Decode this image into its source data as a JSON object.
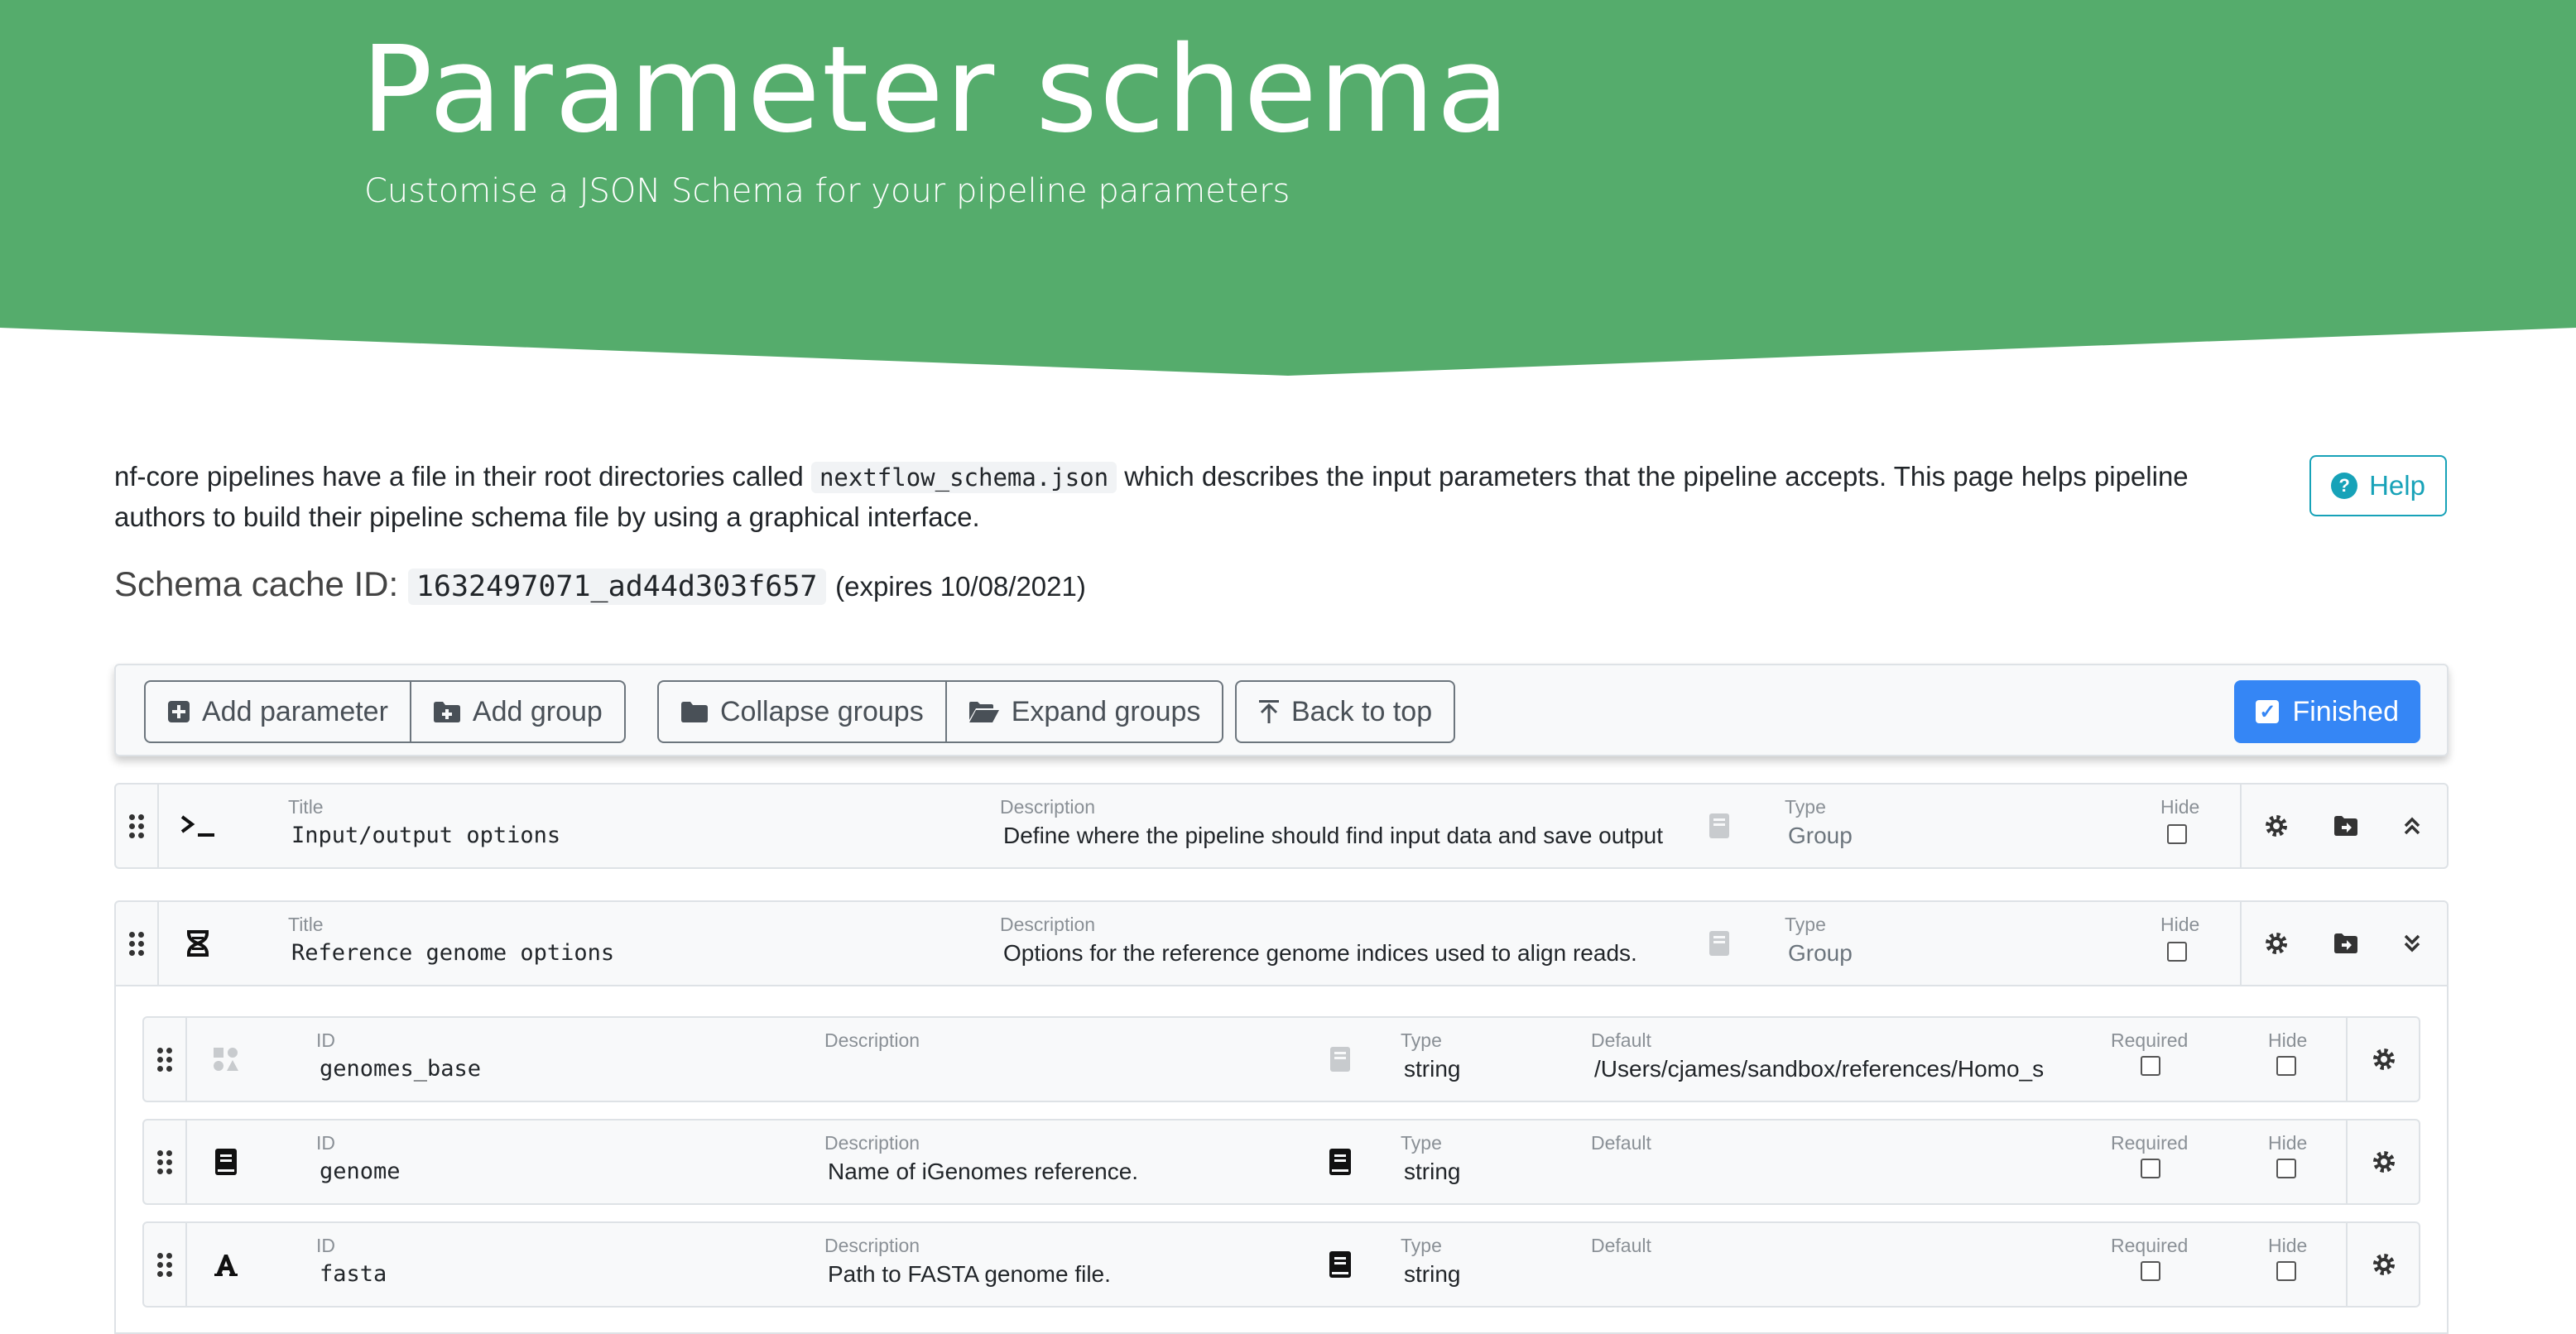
{
  "hero": {
    "title": "Parameter schema",
    "subtitle": "Customise a JSON Schema for your pipeline parameters",
    "color": "#55ac6c"
  },
  "intro": {
    "text_before": "nf-core pipelines have a file in their root directories called ",
    "filename": "nextflow_schema.json",
    "text_after": " which describes the input parameters that the pipeline accepts. This page helps pipeline authors to build their pipeline schema file by using a graphical interface."
  },
  "help_button": {
    "label": "Help",
    "icon": "question-circle-icon"
  },
  "cache": {
    "label": "Schema cache ID:",
    "id": "1632497071_ad44d303f657",
    "expires": "(expires 10/08/2021)"
  },
  "toolbar": {
    "add_parameter": "Add parameter",
    "add_group": "Add group",
    "collapse_groups": "Collapse groups",
    "expand_groups": "Expand groups",
    "back_to_top": "Back to top",
    "finished": "Finished",
    "accent": "#3586f5"
  },
  "labels": {
    "title": "Title",
    "description": "Description",
    "type": "Type",
    "hide": "Hide",
    "id": "ID",
    "default": "Default",
    "required": "Required"
  },
  "groups": [
    {
      "icon": "terminal-icon",
      "title": "Input/output options",
      "description": "Define where the pipeline should find input data and save output data.",
      "type": "Group",
      "collapsed": true
    },
    {
      "icon": "dna-icon",
      "title": "Reference genome options",
      "description": "Options for the reference genome indices used to align reads.",
      "type": "Group",
      "collapsed": false
    }
  ],
  "params": [
    {
      "icon": "shapes-icon",
      "id": "genomes_base",
      "description": "",
      "type": "string",
      "default": "/Users/cjames/sandbox/references/Homo_sapiens"
    },
    {
      "icon": "book-icon",
      "id": "genome",
      "description": "Name of iGenomes reference.",
      "type": "string",
      "default": ""
    },
    {
      "icon": "font-icon",
      "id": "fasta",
      "description": "Path to FASTA genome file.",
      "type": "string",
      "default": ""
    }
  ]
}
